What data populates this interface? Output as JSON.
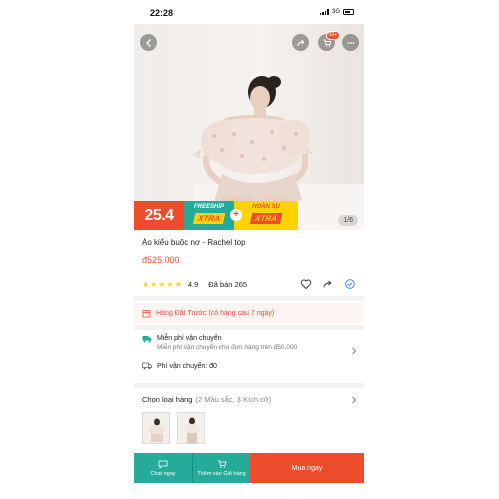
{
  "status_bar": {
    "time": "22:28",
    "network": "3G"
  },
  "cart": {
    "badge": "99+"
  },
  "image": {
    "counter": "1/6"
  },
  "promo": {
    "date": "25.4",
    "freeship_top": "FREESHIP",
    "freeship_bottom": "XTRA",
    "plus": "+",
    "xu_top": "HOÀN XU",
    "xu_bottom": "XTRA"
  },
  "product": {
    "title": "Áo kiểu buộc nơ - Rachel top",
    "price": "đ525.000",
    "rating": "4.9",
    "rating_stars": 5,
    "sold": "Đã bán 265"
  },
  "preorder": {
    "text": "Hàng Đặt Trước (có hàng sau 7 ngày)"
  },
  "shipping": {
    "free_title": "Miễn phí vận chuyển",
    "free_sub": "Miễn phí vận chuyển cho đơn hàng trên đ50.000",
    "fee": "Phí vận chuyển: đ0"
  },
  "variants": {
    "label": "Chọn loại hàng",
    "detail": "(2 Màu sắc, 3 Kích cỡ)"
  },
  "bottom_bar": {
    "chat": "Chat ngay",
    "add_to_cart": "Thêm vào Giỏ hàng",
    "buy": "Mua ngay"
  },
  "colors": {
    "accent": "#ee4d2d",
    "teal": "#26aa99",
    "yellow": "#ffd400"
  }
}
